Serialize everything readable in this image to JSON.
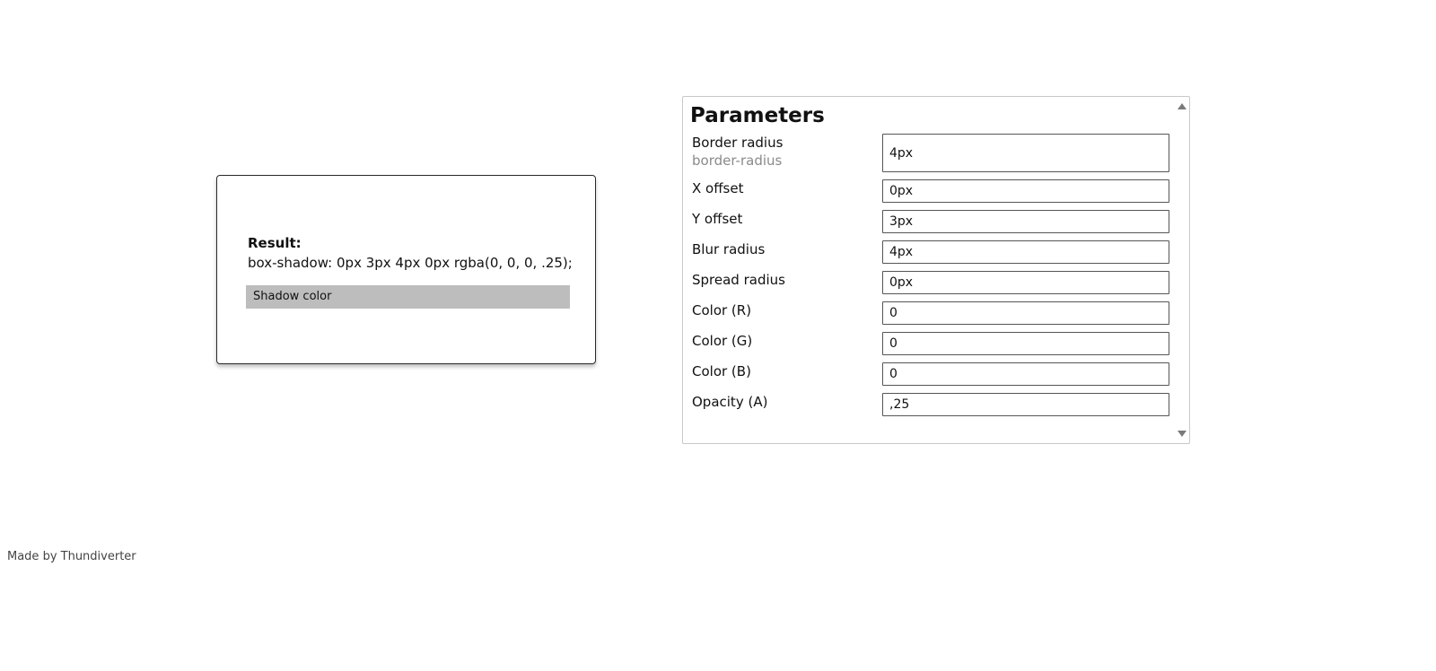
{
  "preview": {
    "result_label": "Result:",
    "result_code": "box-shadow: 0px 3px 4px 0px rgba(0, 0, 0, .25);",
    "shadow_color_label": "Shadow color"
  },
  "parameters": {
    "title": "Parameters",
    "fields": [
      {
        "label": "Border radius",
        "sublabel": "border-radius",
        "value": "4px"
      },
      {
        "label": "X offset",
        "value": "0px"
      },
      {
        "label": "Y offset",
        "value": "3px"
      },
      {
        "label": "Blur radius",
        "value": "4px"
      },
      {
        "label": "Spread radius",
        "value": "0px"
      },
      {
        "label": "Color (R)",
        "value": "0"
      },
      {
        "label": "Color (G)",
        "value": "0"
      },
      {
        "label": "Color (B)",
        "value": "0"
      },
      {
        "label": "Opacity (A)",
        "value": ",25"
      }
    ]
  },
  "footer": {
    "credit": "Made by Thundiverter"
  },
  "colors": {
    "shadow_color_bar": "#bdbdbd",
    "panel_border": "#c8c8c8",
    "sublabel": "#8a8a8a"
  },
  "icons": {
    "scroll_up": "triangle-up-icon",
    "scroll_down": "triangle-down-icon"
  }
}
